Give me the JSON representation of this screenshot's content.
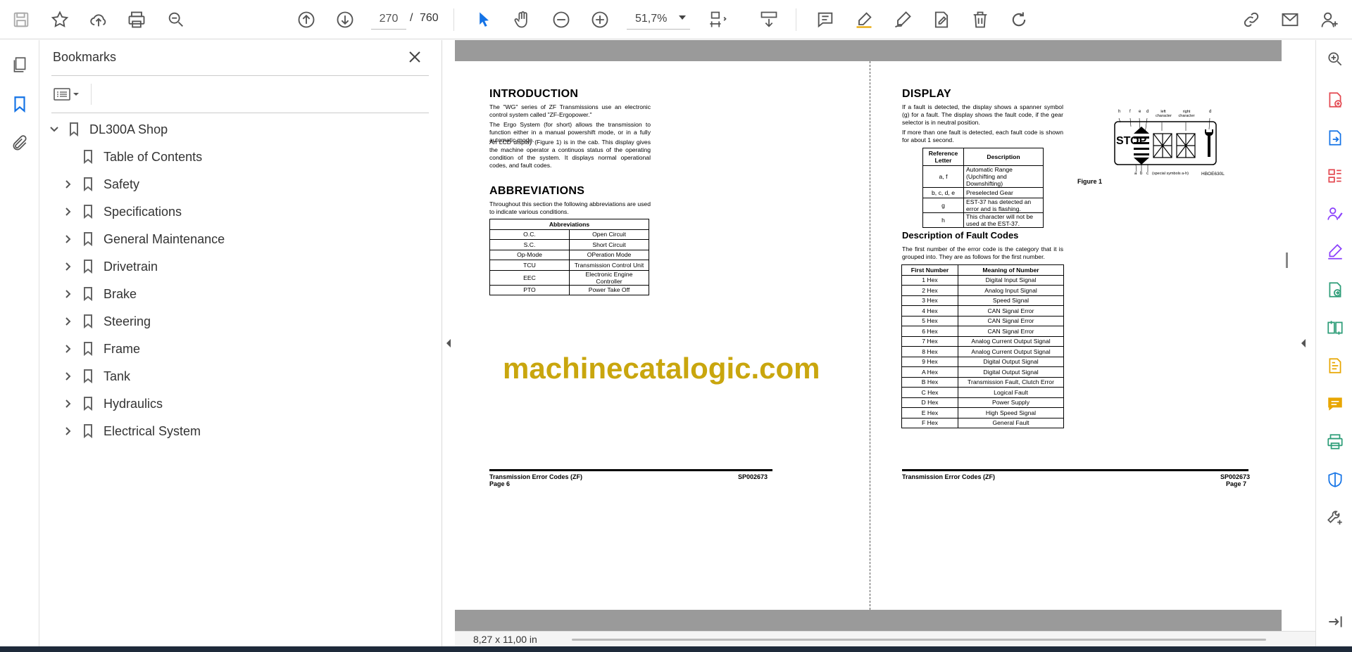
{
  "toolbar": {
    "page_current": "270",
    "page_separator": "/",
    "page_total": "760",
    "zoom": "51,7%"
  },
  "bookmarks": {
    "title": "Bookmarks",
    "items": [
      {
        "label": "DL300A Shop"
      },
      {
        "label": "Table of Contents"
      },
      {
        "label": "Safety"
      },
      {
        "label": "Specifications"
      },
      {
        "label": "General Maintenance"
      },
      {
        "label": "Drivetrain"
      },
      {
        "label": "Brake"
      },
      {
        "label": "Steering"
      },
      {
        "label": "Frame"
      },
      {
        "label": "Tank"
      },
      {
        "label": "Hydraulics"
      },
      {
        "label": "Electrical System"
      }
    ]
  },
  "status": {
    "page_size": "8,27 x 11,00 in"
  },
  "watermark": "machinecatalogic.com",
  "left_page": {
    "intro_heading": "INTRODUCTION",
    "intro_p1": "The \"WG\" series of ZF Transmissions use an electronic control system called \"ZF-Ergopower.\"",
    "intro_p2": "The Ergo System (for short) allows the transmission to function either in a manual powershift mode, or in a fully automatic mode.",
    "intro_p3": "An LCD display (Figure 1) is in the cab. This display gives the machine operator a continuos status of the operating condition of the system. It displays normal operational codes, and fault codes.",
    "abbr_heading": "ABBREVIATIONS",
    "abbr_p1": "Throughout this section the following abbreviations are used to indicate various conditions.",
    "abbr_table_title": "Abbreviations",
    "abbr_rows": [
      [
        "O.C.",
        "Open Circuit"
      ],
      [
        "S.C.",
        "Short Circuit"
      ],
      [
        "Op-Mode",
        "OPeration Mode"
      ],
      [
        "TCU",
        "Transmission Control Unit"
      ],
      [
        "EEC",
        "Electronic Engine Controller"
      ],
      [
        "PTO",
        "Power Take Off"
      ]
    ],
    "footer_title": "Transmission Error Codes (ZF)",
    "footer_page": "Page 6",
    "footer_code": "SP002673"
  },
  "right_page": {
    "display_heading": "DISPLAY",
    "display_p1": "If a fault is detected, the display shows a spanner symbol (g) for a fault. The display shows the fault code, if the gear selector is in neutral position.",
    "display_p2": "If more than one fault is detected, each fault code is shown for about 1 second.",
    "ref_headers": [
      "Reference Letter",
      "Description"
    ],
    "ref_rows": [
      [
        "a, f",
        "Automatic Range (Upchifting and Downshifting)"
      ],
      [
        "b, c, d, e",
        "Preselected Gear"
      ],
      [
        "g",
        "EST-37 has detected an error and is flashing."
      ],
      [
        "h",
        "This character will not be used at the EST-37."
      ]
    ],
    "figure_caption": "Figure 1",
    "figure_labels": {
      "h": "h",
      "f": "f",
      "e": "e",
      "d": "d",
      "left_char": "left character",
      "right_char": "right character",
      "d2": "d",
      "a": "a",
      "b": "b",
      "c": "c",
      "special": "(special symbols a-h)",
      "code": "HBOE630L",
      "stop": "STOP"
    },
    "fault_heading": "Description of Fault Codes",
    "fault_p1": "The first number of the error code is the category that it is grouped into. They are as follows for the first number.",
    "fault_headers": [
      "First Number",
      "Meaning of Number"
    ],
    "fault_rows": [
      [
        "1 Hex",
        "Digital Input Signal"
      ],
      [
        "2 Hex",
        "Analog Input Signal"
      ],
      [
        "3 Hex",
        "Speed Signal"
      ],
      [
        "4 Hex",
        "CAN Signal Error"
      ],
      [
        "5 Hex",
        "CAN Signal Error"
      ],
      [
        "6 Hex",
        "CAN Signal Error"
      ],
      [
        "7 Hex",
        "Analog Current Output Signal"
      ],
      [
        "8 Hex",
        "Analog Current Output Signal"
      ],
      [
        "9 Hex",
        "Digital Output Signal"
      ],
      [
        "A Hex",
        "Digital Output Signal"
      ],
      [
        "B Hex",
        "Transmission Fault, Clutch Error"
      ],
      [
        "C Hex",
        "Logical Fault"
      ],
      [
        "D Hex",
        "Power Supply"
      ],
      [
        "E Hex",
        "High Speed Signal"
      ],
      [
        "F Hex",
        "General Fault"
      ]
    ],
    "footer_title": "Transmission Error Codes (ZF)",
    "footer_page": "Page 7",
    "footer_code": "SP002673"
  },
  "icons": {
    "accent": "#1473e6",
    "purple": "#8a3ffc",
    "red": "#e34850",
    "green": "#2d9d78",
    "yellow": "#e8a600"
  }
}
